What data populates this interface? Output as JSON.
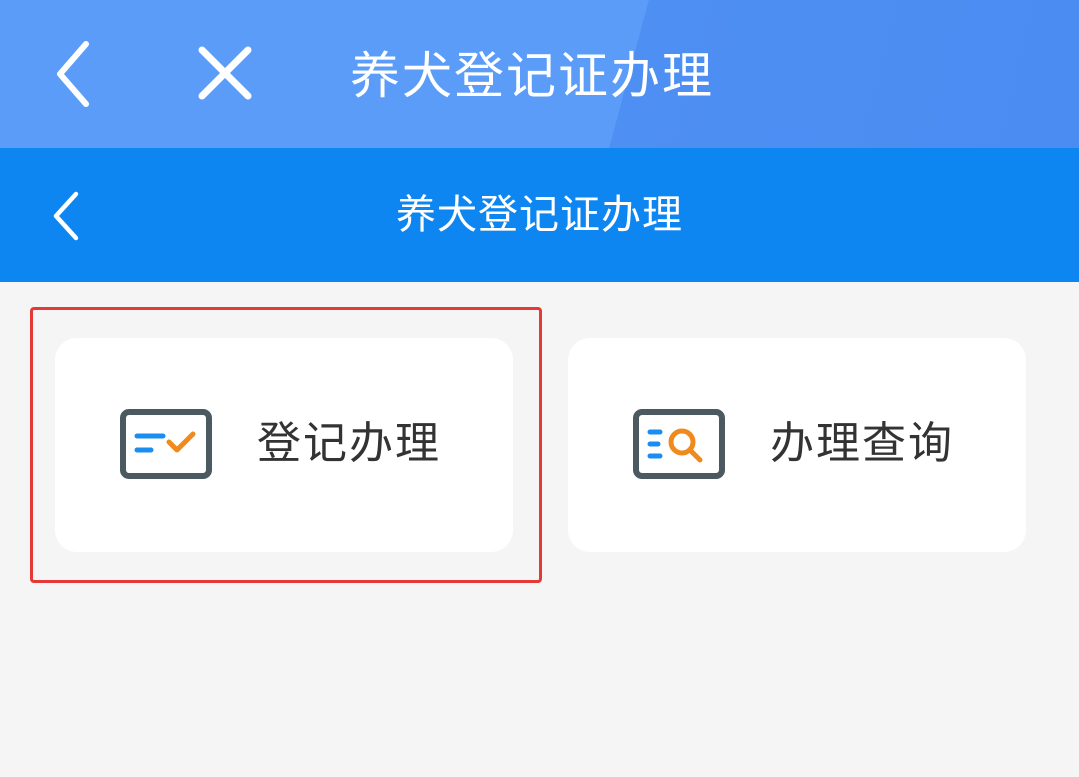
{
  "topbar": {
    "back_icon": "chevron-left-icon",
    "close_icon": "close-icon",
    "title": "养犬登记证办理"
  },
  "navbar": {
    "back_icon": "chevron-left-icon",
    "title": "养犬登记证办理"
  },
  "cards": [
    {
      "label": "登记办理",
      "icon": "register-check-icon",
      "highlighted": true
    },
    {
      "label": "办理查询",
      "icon": "query-search-icon",
      "highlighted": false
    }
  ],
  "colors": {
    "topbar_bg": "#5a9cf8",
    "navbar_bg": "#0d86f2",
    "page_bg": "#f5f5f5",
    "card_bg": "#ffffff",
    "highlight": "#e53935",
    "icon_blue": "#1a8ef0",
    "icon_orange": "#f08a1c",
    "icon_frame": "#4a5a60"
  }
}
